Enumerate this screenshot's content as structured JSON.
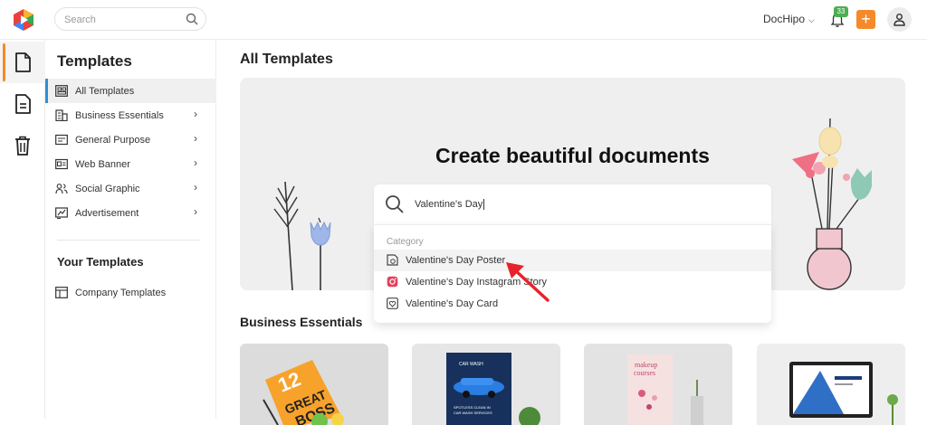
{
  "topbar": {
    "search_placeholder": "Search",
    "account_label": "DocHipo",
    "notification_count": "33",
    "plus_label": "+"
  },
  "sidebar": {
    "title": "Templates",
    "items": [
      {
        "label": "All Templates",
        "icon": "grid-icon",
        "active": true
      },
      {
        "label": "Business Essentials",
        "icon": "building-icon"
      },
      {
        "label": "General Purpose",
        "icon": "id-card-icon"
      },
      {
        "label": "Web Banner",
        "icon": "banner-icon"
      },
      {
        "label": "Social Graphic",
        "icon": "people-icon"
      },
      {
        "label": "Advertisement",
        "icon": "megaphone-icon"
      }
    ],
    "your_templates_title": "Your Templates",
    "your_items": [
      {
        "label": "Company Templates",
        "icon": "layout-icon"
      }
    ]
  },
  "main": {
    "title": "All Templates",
    "hero": {
      "title": "Create beautiful documents",
      "search_value": "Valentine's Day"
    },
    "dropdown": {
      "category_label": "Category",
      "items": [
        {
          "label": "Valentine's Day Poster",
          "icon": "poster-icon"
        },
        {
          "label": "Valentine's Day Instagram Story",
          "icon": "instagram-icon"
        },
        {
          "label": "Valentine's Day Card",
          "icon": "card-icon"
        }
      ]
    },
    "section_title": "Business Essentials",
    "cards": [
      {
        "icon": "flyer-thumbnail-icon"
      },
      {
        "icon": "car-wash-thumbnail-icon"
      },
      {
        "icon": "makeup-courses-thumbnail-icon"
      },
      {
        "icon": "laptop-thumbnail-icon"
      }
    ]
  },
  "colors": {
    "accent_orange": "#f48a2a",
    "active_blue": "#2f8fd8",
    "badge_green": "#4caf50",
    "arrow_red": "#e8222a"
  }
}
